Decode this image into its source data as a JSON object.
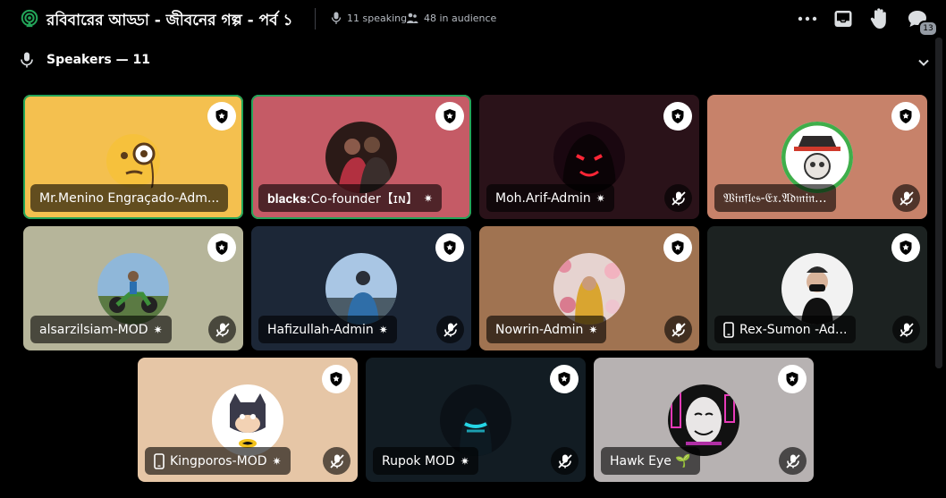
{
  "header": {
    "title": "রবিবারের আড্ডা - জীবনের গল্প - পর্ব ১",
    "speaking": "11 speaking",
    "audience": "48 in audience",
    "notification_count": "13"
  },
  "speakers_section": {
    "label": "Speakers — 11"
  },
  "colors": {
    "selected_border": "#23a559",
    "background": "#000000"
  },
  "tiles": [
    {
      "name": "Mr.Menino Engraçado-Adm...",
      "bg": "#f4c04f",
      "avatar": "monocle-emoji-avatar",
      "selected": true,
      "muted": false,
      "mod": false,
      "mobile": false
    },
    {
      "name": "𝐛𝐥𝐚𝐜𝐤𝐬:Co-founder【ɪɴ】",
      "bg": "#c55b66",
      "avatar": "couple-photo-avatar",
      "selected": true,
      "muted": false,
      "mod": true,
      "mobile": false
    },
    {
      "name": "Moh.Arif-Admin",
      "bg": "#2a1219",
      "avatar": "hooded-figure-avatar",
      "selected": false,
      "muted": true,
      "mod": true,
      "mobile": false
    },
    {
      "name": "𝔚𝔦𝔫𝔣𝔩𝔢𝔰-𝔈𝔵.𝔄𝔡𝔪𝔦𝔫...",
      "bg": "#c7826a",
      "avatar": "skull-hat-avatar",
      "selected": false,
      "muted": true,
      "mod": false,
      "mobile": false
    },
    {
      "name": "alsarzilsiam-MOD",
      "bg": "#b6b59a",
      "avatar": "motorbike-avatar",
      "selected": false,
      "muted": true,
      "mod": true,
      "mobile": false
    },
    {
      "name": "Hafizullah-Admin",
      "bg": "#1c2737",
      "avatar": "man-landscape-avatar",
      "selected": false,
      "muted": true,
      "mod": true,
      "mobile": false
    },
    {
      "name": "Nowrin-Admin",
      "bg": "#a07351",
      "avatar": "flowers-woman-avatar",
      "selected": false,
      "muted": true,
      "mod": true,
      "mobile": false
    },
    {
      "name": "Rex-Sumon -Ad...",
      "bg": "#1c2221",
      "avatar": "masked-man-avatar",
      "selected": false,
      "muted": true,
      "mod": false,
      "mobile": true
    },
    {
      "name": "Kingporos-MOD",
      "bg": "#e6c6a6",
      "avatar": "batman-avatar",
      "selected": false,
      "muted": true,
      "mod": true,
      "mobile": true
    },
    {
      "name": "Rupok MOD",
      "bg": "#121c23",
      "avatar": "neon-mask-avatar",
      "selected": false,
      "muted": true,
      "mod": true,
      "mobile": false
    },
    {
      "name": "Hawk Eye 🌱",
      "bg": "#b7b2b2",
      "avatar": "anonymous-mask-avatar",
      "selected": false,
      "muted": true,
      "mod": false,
      "mobile": false
    }
  ]
}
